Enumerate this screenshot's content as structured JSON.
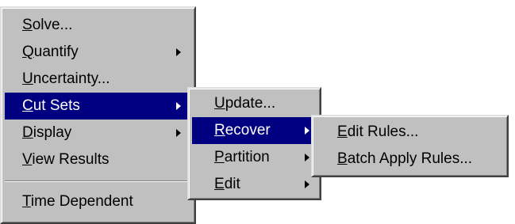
{
  "main_menu": {
    "items": [
      {
        "accel": "S",
        "rest": "olve..."
      },
      {
        "accel": "Q",
        "rest": "uantify"
      },
      {
        "accel": "U",
        "rest": "ncertainty..."
      },
      {
        "accel": "C",
        "rest": "ut Sets"
      },
      {
        "accel": "D",
        "rest": "isplay"
      },
      {
        "accel": "V",
        "rest": "iew Results"
      },
      {
        "accel": "T",
        "rest": "ime Dependent"
      }
    ]
  },
  "cut_sets_menu": {
    "items": [
      {
        "accel": "U",
        "rest": "pdate..."
      },
      {
        "accel": "R",
        "rest": "ecover"
      },
      {
        "accel": "P",
        "rest": "artition"
      },
      {
        "accel": "E",
        "rest": "dit"
      }
    ]
  },
  "recover_menu": {
    "items": [
      {
        "accel": "E",
        "rest": "dit Rules..."
      },
      {
        "accel": "B",
        "rest": "atch Apply Rules..."
      }
    ]
  },
  "colors": {
    "menu_bg": "#c0c0c0",
    "highlight_bg": "#000080",
    "highlight_text": "#ffffff"
  }
}
